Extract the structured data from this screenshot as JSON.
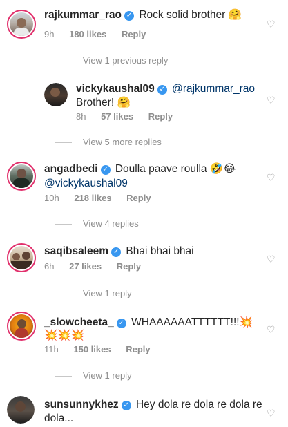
{
  "comments": [
    {
      "user": "rajkummar_rao",
      "text": "Rock solid brother 🤗",
      "time": "9h",
      "likes": "180 likes",
      "reply": "Reply"
    },
    {
      "user": "vickykaushal09",
      "mention": "@rajkummar_rao",
      "text": "Brother! 🤗",
      "time": "8h",
      "likes": "57 likes",
      "reply": "Reply"
    },
    {
      "user": "angadbedi",
      "text": "Doulla paave roulla 🤣😂",
      "mention": "@vickykaushal09",
      "time": "10h",
      "likes": "218 likes",
      "reply": "Reply"
    },
    {
      "user": "saqibsaleem",
      "text": "Bhai bhai bhai",
      "time": "6h",
      "likes": "27 likes",
      "reply": "Reply"
    },
    {
      "user": "_slowcheeta_",
      "text": "WHAAAAAATTTTTT!!!💥",
      "text2": "💥💥💥",
      "time": "11h",
      "likes": "150 likes",
      "reply": "Reply"
    },
    {
      "user": "sunsunnykhez",
      "text": "Hey dola re dola re dola re",
      "text2": "dola...",
      "time": "",
      "likes": "",
      "reply": ""
    }
  ],
  "view_links": {
    "previous": "View 1 previous reply",
    "five": "View 5 more replies",
    "four": "View 4 replies",
    "one_a": "View 1 reply",
    "one_b": "View 1 reply"
  },
  "icons": {
    "heart": "heart-outline-icon",
    "verified": "verified-badge-icon"
  },
  "colors": {
    "verified": "#3897f0",
    "mention": "#003569",
    "muted": "#8e8e8e",
    "ring": "#e1306c"
  }
}
